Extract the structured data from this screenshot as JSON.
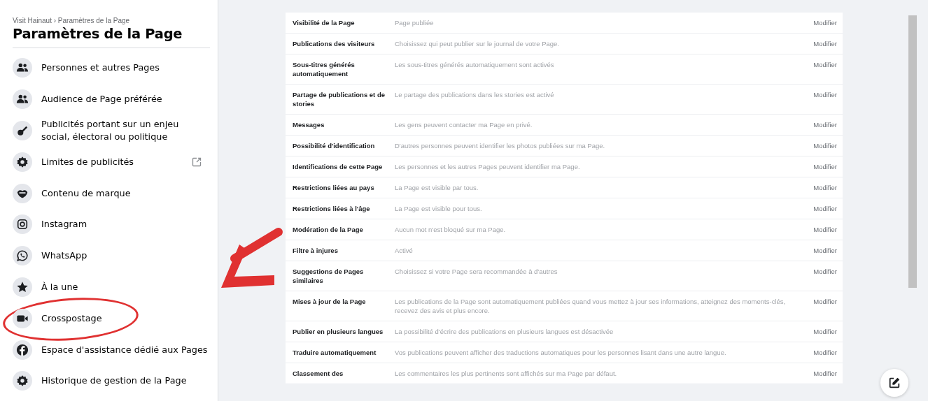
{
  "sidebar": {
    "breadcrumb": "Visit Hainaut › Paramètres de la Page",
    "title": "Paramètres de la Page",
    "items": [
      {
        "label": "Personnes et autres Pages",
        "kind": "people",
        "external": false,
        "circled": false
      },
      {
        "label": "Audience de Page préférée",
        "kind": "people",
        "external": false,
        "circled": false
      },
      {
        "label": "Publicités portant sur un enjeu social, électoral ou politique",
        "kind": "key",
        "external": false,
        "circled": false
      },
      {
        "label": "Limites de publicités",
        "kind": "gear",
        "external": true,
        "circled": false
      },
      {
        "label": "Contenu de marque",
        "kind": "handshake",
        "external": false,
        "circled": false
      },
      {
        "label": "Instagram",
        "kind": "camera",
        "external": false,
        "circled": false
      },
      {
        "label": "WhatsApp",
        "kind": "chat",
        "external": false,
        "circled": false
      },
      {
        "label": "À la une",
        "kind": "star",
        "external": false,
        "circled": false
      },
      {
        "label": "Crosspostage",
        "kind": "video",
        "external": false,
        "circled": true
      },
      {
        "label": "Espace d'assistance dédié aux Pages",
        "kind": "fcircle",
        "external": false,
        "circled": false
      },
      {
        "label": "Historique de gestion de la Page",
        "kind": "gear",
        "external": false,
        "circled": false
      }
    ]
  },
  "settings": [
    {
      "name": "Visibilité de la Page",
      "value": "Page publiée",
      "action": "Modifier"
    },
    {
      "name": "Publications des visiteurs",
      "value": "Choisissez qui peut publier sur le journal de votre Page.",
      "action": "Modifier"
    },
    {
      "name": "Sous-titres générés automatiquement",
      "value": "Les sous-titres générés automatiquement sont activés",
      "action": "Modifier"
    },
    {
      "name": "Partage de publications et de stories",
      "value": "Le partage des publications dans les stories est activé",
      "action": "Modifier"
    },
    {
      "name": "Messages",
      "value": "Les gens peuvent contacter ma Page en privé.",
      "action": "Modifier"
    },
    {
      "name": "Possibilité d'identification",
      "value": "D'autres personnes peuvent identifier les photos publiées sur ma Page.",
      "action": "Modifier"
    },
    {
      "name": "Identifications de cette Page",
      "value": "Les personnes et les autres Pages peuvent identifier ma Page.",
      "action": "Modifier"
    },
    {
      "name": "Restrictions liées au pays",
      "value": "La Page est visible par tous.",
      "action": "Modifier"
    },
    {
      "name": "Restrictions liées à l'âge",
      "value": "La Page est visible pour tous.",
      "action": "Modifier"
    },
    {
      "name": "Modération de la Page",
      "value": "Aucun mot n'est bloqué sur ma Page.",
      "action": "Modifier"
    },
    {
      "name": "Filtre à injures",
      "value": "Activé",
      "action": "Modifier"
    },
    {
      "name": "Suggestions de Pages similaires",
      "value": "Choisissez si votre Page sera recommandée à d'autres",
      "action": "Modifier"
    },
    {
      "name": "Mises à jour de la Page",
      "value": "Les publications de la Page sont automatiquement publiées quand vous mettez à jour ses informations, atteignez des moments-clés, recevez des avis et plus encore.",
      "action": "Modifier"
    },
    {
      "name": "Publier en plusieurs langues",
      "value": "La possibilité d'écrire des publications en plusieurs langues est désactivée",
      "action": "Modifier"
    },
    {
      "name": "Traduire automatiquement",
      "value": "Vos publications peuvent afficher des traductions automatiques pour les personnes lisant dans une autre langue.",
      "action": "Modifier"
    },
    {
      "name": "Classement des",
      "value": "Les commentaires les plus pertinents sont affichés sur ma Page par défaut.",
      "action": "Modifier"
    }
  ]
}
